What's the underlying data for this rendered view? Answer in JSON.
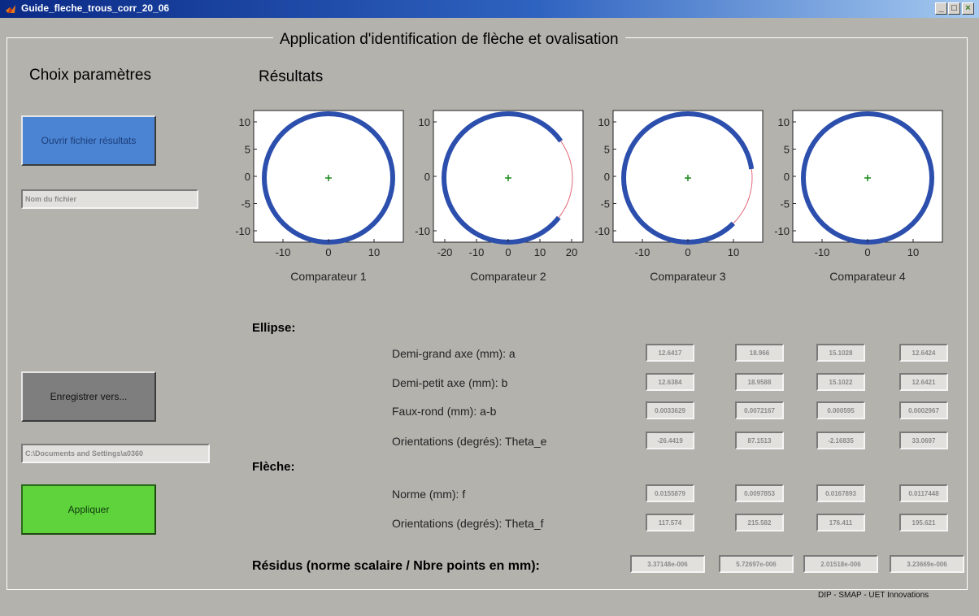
{
  "window": {
    "title": "Guide_fleche_trous_corr_20_06",
    "title_bar_color": "#0a2a86"
  },
  "app": {
    "main_title": "Application d'identification de flèche et ovalisation",
    "credit": "DIP - SMAP - UET Innovations"
  },
  "left_panel": {
    "heading": "Choix paramètres",
    "open_button_label": "Ouvrir fichier résultats",
    "filename_field": "Nom du fichier",
    "save_button_label": "Enregistrer vers...",
    "save_path_field": "C:\\Documents and Settings\\a0360",
    "apply_button_label": "Appliquer",
    "colors": {
      "open_button": "#4a84d2",
      "save_button": "#7e7e7e",
      "apply_button": "#5fd33c"
    }
  },
  "results": {
    "heading": "Résultats",
    "plots": [
      {
        "caption": "Comparateur 1",
        "yticks": [
          "10",
          "5",
          "0",
          "-5",
          "-10"
        ],
        "xticks": [
          "-10",
          "0",
          "10"
        ],
        "arc_gap": "none"
      },
      {
        "caption": "Comparateur 2",
        "yticks": [
          "10",
          "0",
          "-10"
        ],
        "xticks": [
          "-20",
          "-10",
          "0",
          "10",
          "20"
        ],
        "arc_gap": "right"
      },
      {
        "caption": "Comparateur 3",
        "yticks": [
          "10",
          "5",
          "0",
          "-5",
          "-10"
        ],
        "xticks": [
          "-10",
          "0",
          "10"
        ],
        "arc_gap": "lower-right"
      },
      {
        "caption": "Comparateur 4",
        "yticks": [
          "10",
          "5",
          "0",
          "-5",
          "-10"
        ],
        "xticks": [
          "-10",
          "0",
          "10"
        ],
        "arc_gap": "none"
      }
    ],
    "plot_colors": {
      "circle": "#2c4fad",
      "gap": "#e06a7a",
      "center": "#1b8a1b"
    }
  },
  "ellipse": {
    "heading": "Ellipse:",
    "rows": [
      {
        "label": "Demi-grand axe (mm):   a",
        "values": [
          "12.6417",
          "18.966",
          "15.1028",
          "12.6424"
        ]
      },
      {
        "label": "Demi-petit axe (mm):  b",
        "values": [
          "12.6384",
          "18.9588",
          "15.1022",
          "12.6421"
        ]
      },
      {
        "label": "Faux-rond (mm): a-b",
        "values": [
          "0.0033629",
          "0.0072167",
          "0.000595",
          "0.0002967"
        ]
      },
      {
        "label": "Orientations (degrés): Theta_e",
        "values": [
          "-26.4419",
          "87.1513",
          "-2.16835",
          "33.0697"
        ]
      }
    ]
  },
  "fleche": {
    "heading": "Flèche:",
    "rows": [
      {
        "label": "Norme (mm): f",
        "values": [
          "0.0155879",
          "0.0097853",
          "0.0167893",
          "0.0117448"
        ]
      },
      {
        "label": "Orientations (degrés): Theta_f",
        "values": [
          "117.574",
          "215.582",
          "176.411",
          "195.621"
        ]
      }
    ]
  },
  "residus": {
    "label": "Résidus (norme scalaire / Nbre points en mm):",
    "values": [
      "3.37148e-006",
      "5.72697e-006",
      "2.01518e-006",
      "3.23669e-006"
    ]
  }
}
